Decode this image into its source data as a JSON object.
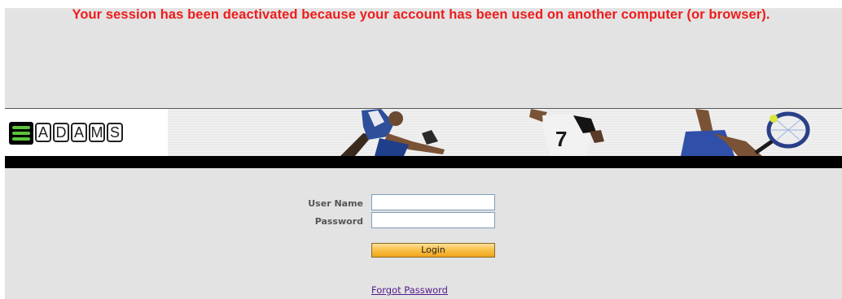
{
  "session_message": "Your session has been deactivated because your account has been used on another computer (or browser).",
  "banner": {
    "logo_letters": [
      "A",
      "D",
      "A",
      "M",
      "S"
    ],
    "accent_color": "#5cc33b"
  },
  "login_form": {
    "username_label": "User Name",
    "password_label": "Password",
    "username_value": "",
    "password_value": "",
    "login_button": "Login",
    "forgot_password_link": "Forgot Password"
  },
  "colors": {
    "message": "#ee1c1c",
    "background": "#e3e3e3",
    "button": "#f9c24b",
    "link": "#551a8b"
  }
}
